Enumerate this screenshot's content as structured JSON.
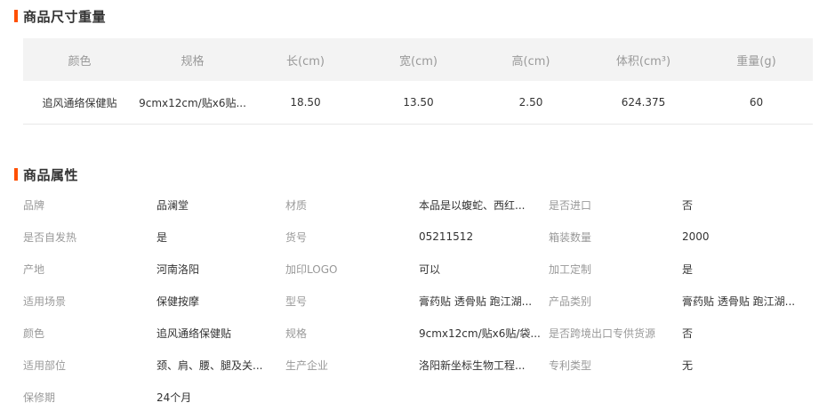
{
  "dimensions_section": {
    "title": "商品尺寸重量",
    "headers": [
      "颜色",
      "规格",
      "长(cm)",
      "宽(cm)",
      "高(cm)",
      "体积(cm³)",
      "重量(g)"
    ],
    "row": [
      "追风通络保健贴",
      "9cmx12cm/贴x6贴...",
      "18.50",
      "13.50",
      "2.50",
      "624.375",
      "60"
    ]
  },
  "attributes_section": {
    "title": "商品属性",
    "rows": [
      [
        {
          "label": "品牌",
          "value": "品澜堂"
        },
        {
          "label": "材质",
          "value": "本品是以蝮蛇、西红..."
        },
        {
          "label": "是否进口",
          "value": "否"
        }
      ],
      [
        {
          "label": "是否自发热",
          "value": "是"
        },
        {
          "label": "货号",
          "value": "05211512"
        },
        {
          "label": "箱装数量",
          "value": "2000"
        }
      ],
      [
        {
          "label": "产地",
          "value": "河南洛阳"
        },
        {
          "label": "加印LOGO",
          "value": "可以"
        },
        {
          "label": "加工定制",
          "value": "是"
        }
      ],
      [
        {
          "label": "适用场景",
          "value": "保健按摩"
        },
        {
          "label": "型号",
          "value": "膏药贴 透骨贴 跑江湖..."
        },
        {
          "label": "产品类别",
          "value": "膏药贴 透骨贴 跑江湖..."
        }
      ],
      [
        {
          "label": "颜色",
          "value": "追风通络保健贴"
        },
        {
          "label": "规格",
          "value": "9cmx12cm/贴x6贴/袋..."
        },
        {
          "label": "是否跨境出口专供货源",
          "value": "否"
        }
      ],
      [
        {
          "label": "适用部位",
          "value": "颈、肩、腰、腿及关..."
        },
        {
          "label": "生产企业",
          "value": "洛阳新坐标生物工程..."
        },
        {
          "label": "专利类型",
          "value": "无"
        }
      ],
      [
        {
          "label": "保修期",
          "value": "24个月"
        }
      ]
    ]
  },
  "colors": {
    "accent": "#ff5000",
    "header_bg": "#f3f3f3",
    "label": "#999999",
    "text": "#333333"
  }
}
